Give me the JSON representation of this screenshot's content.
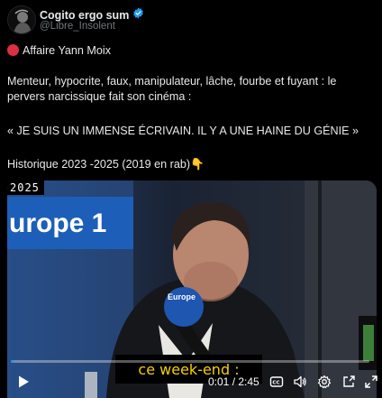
{
  "author": {
    "name": "Cogito ergo sum",
    "handle": "@Libre_Insolent"
  },
  "post": {
    "line1": "Affaire Yann Moix",
    "line2": "Menteur, hypocrite, faux, manipulateur, lâche, fourbe et fuyant : le pervers narcissique fait son cinéma :",
    "line3": "« JE SUIS UN IMMENSE ÉCRIVAIN. IL Y A UNE HAINE DU GÉNIE »",
    "line4": "Historique 2023 -2025 (2019 en rab)👇"
  },
  "video": {
    "year_badge": "2025",
    "station_logo": "urope 1",
    "mic_label": "Europe",
    "caption": "ce week-end :",
    "time": "0:01 / 2:45",
    "progress": 0.006
  },
  "colors": {
    "accent": "#1d9bf0",
    "caption": "#f5d000",
    "status": "#dd2e44"
  },
  "icons": [
    "verified-badge-icon",
    "red-circle-icon",
    "play-icon",
    "cc-icon",
    "volume-icon",
    "settings-icon",
    "pip-icon",
    "fullscreen-icon"
  ]
}
